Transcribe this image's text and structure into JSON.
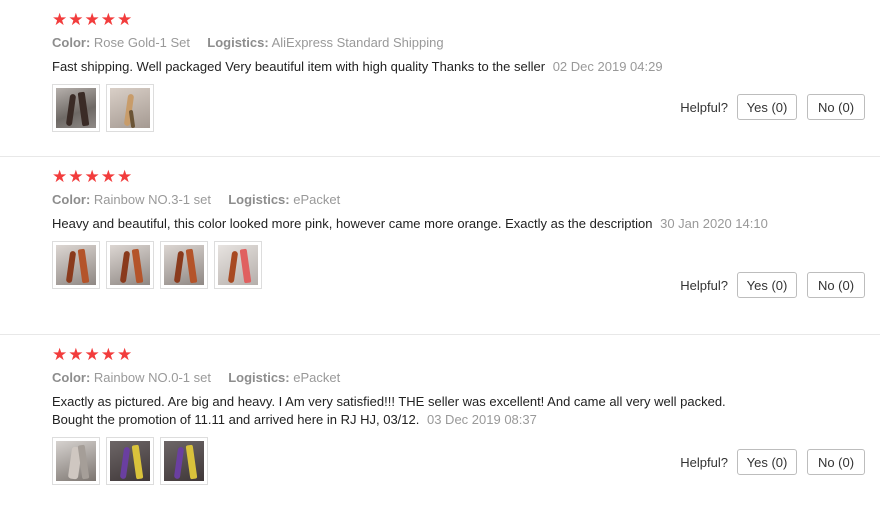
{
  "colors": {
    "star": "#f23c3c",
    "muted": "#999999"
  },
  "reviews": [
    {
      "rating": 5,
      "color_label": "Color:",
      "color_value": "Rose Gold-1 Set",
      "logistics_label": "Logistics:",
      "logistics_value": "AliExpress Standard Shipping",
      "text": "Fast shipping. Well packaged Very beautiful item with high quality Thanks to the seller",
      "date": "02 Dec 2019 04:29",
      "images": [
        "gray",
        "rose"
      ],
      "helpful_label": "Helpful?",
      "yes_label": "Yes (0)",
      "no_label": "No (0)"
    },
    {
      "rating": 5,
      "color_label": "Color:",
      "color_value": "Rainbow NO.3-1 set",
      "logistics_label": "Logistics:",
      "logistics_value": "ePacket",
      "text": "Heavy and beautiful, this color looked more pink, however came more orange. Exactly as the description",
      "date": "30 Jan 2020 14:10",
      "images": [
        "rb",
        "rb",
        "rb",
        "rb2"
      ],
      "helpful_label": "Helpful?",
      "yes_label": "Yes (0)",
      "no_label": "No (0)"
    },
    {
      "rating": 5,
      "color_label": "Color:",
      "color_value": "Rainbow NO.0-1 set",
      "logistics_label": "Logistics:",
      "logistics_value": "ePacket",
      "text_line1": "Exactly as pictured. Are big and heavy. I Am very satisfied!!! THE seller was excellent! And came all very well packed.",
      "text_line2": "Bought the promotion of 11.11 and arrived here in RJ HJ, 03/12.",
      "date": "03 Dec 2019 08:37",
      "images": [
        "grey2",
        "purple",
        "purple"
      ],
      "helpful_label": "Helpful?",
      "yes_label": "Yes (0)",
      "no_label": "No (0)"
    }
  ]
}
